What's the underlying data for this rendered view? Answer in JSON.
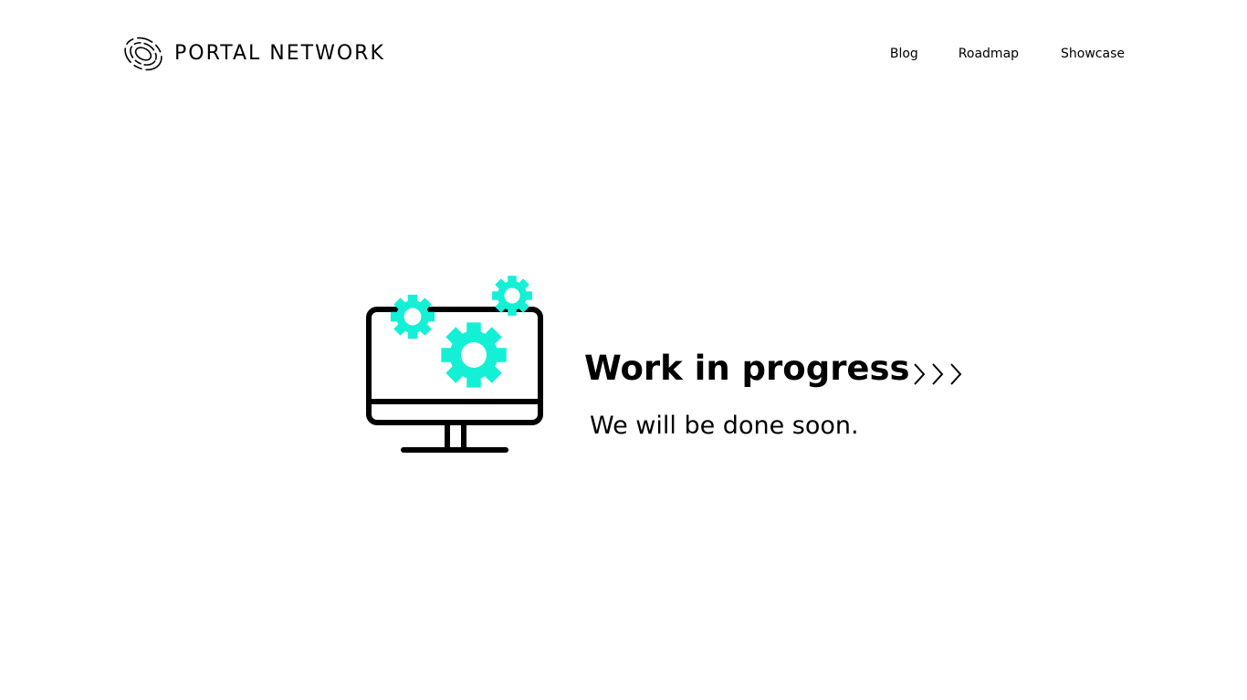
{
  "header": {
    "logo_text": "PORTAL NETWORK",
    "logo_icon": "portal-swirl-icon",
    "nav": [
      {
        "label": "Blog"
      },
      {
        "label": "Roadmap"
      },
      {
        "label": "Showcase"
      }
    ]
  },
  "main": {
    "title": "Work in progress",
    "subtitle": "We will be done soon.",
    "illustration_icon": "monitor-with-gears-icon",
    "arrows_icon": "triple-chevron-right-icon"
  },
  "colors": {
    "accent": "#14f0d6",
    "text": "#000000",
    "background": "#ffffff"
  }
}
